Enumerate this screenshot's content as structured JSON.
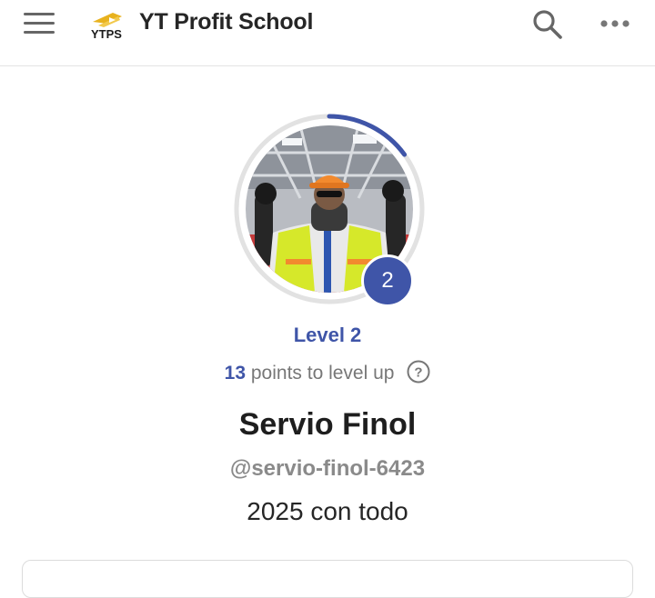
{
  "header": {
    "app_name": "YT Profit School",
    "logo_text": "YTPS",
    "icons": [
      "menu-icon",
      "search-icon",
      "more-icon"
    ]
  },
  "profile": {
    "level_badge": "2",
    "level_label": "Level 2",
    "points_to_level": "13",
    "points_text": " points to level up",
    "level_progress": 0.15,
    "name": "Servio Finol",
    "handle": "@servio-finol-6423",
    "bio": "2025 con todo"
  },
  "colors": {
    "accent": "#3f55a8",
    "logo_gold": "#e8b21e",
    "ring_track": "#e2e2e2"
  }
}
